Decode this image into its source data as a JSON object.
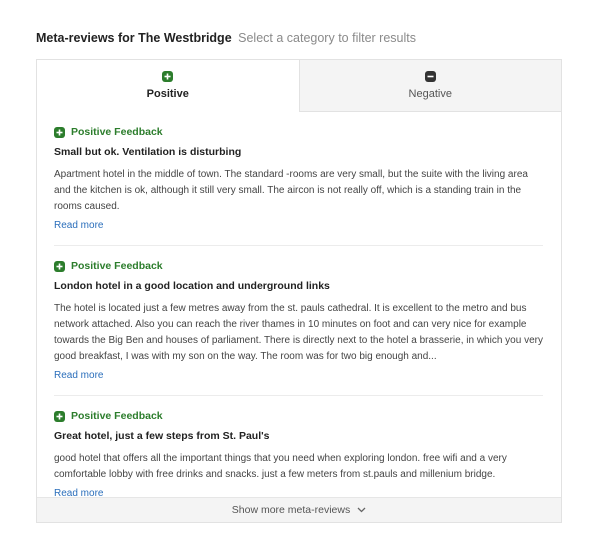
{
  "header": {
    "title": "Meta-reviews for The Westbridge",
    "subtitle": "Select a category to filter results"
  },
  "tabs": [
    {
      "label": "Positive",
      "icon": "plus-square-icon",
      "active": true
    },
    {
      "label": "Negative",
      "icon": "minus-square-icon",
      "active": false
    }
  ],
  "reviews": [
    {
      "feedback_label": "Positive Feedback",
      "title": "Small but ok. Ventilation is disturbing",
      "text": "Apartment hotel in the middle of town. The standard -rooms are very small, but the suite with the living area and the kitchen is ok, although it still very small. The aircon is not really off, which is a standing train in the rooms caused.",
      "read_more": "Read more"
    },
    {
      "feedback_label": "Positive Feedback",
      "title": "London hotel in a good location and underground links",
      "text": "The hotel is located just a few metres away from the st. pauls cathedral. It is excellent to the metro and bus network attached. Also you can reach the river thames in 10 minutes on foot and can very nice for example towards the Big Ben and houses of parliament. There is directly next to the hotel a brasserie, in which you very good breakfast, I was with my son on the way. The room was for two big enough and...",
      "read_more": "Read more"
    },
    {
      "feedback_label": "Positive Feedback",
      "title": "Great hotel, just a few steps from St. Paul's",
      "text": "good hotel that offers all the important things that you need when exploring london. free wifi and a very comfortable lobby with free drinks and snacks. just a few meters from st.pauls and millenium bridge.",
      "read_more": "Read more"
    }
  ],
  "show_more": {
    "label": "Show more meta-reviews",
    "icon": "chevron-down-icon"
  },
  "colors": {
    "positive": "#2c7d2c",
    "link": "#2a6ebb",
    "tab_inactive_bg": "#f4f4f4"
  }
}
